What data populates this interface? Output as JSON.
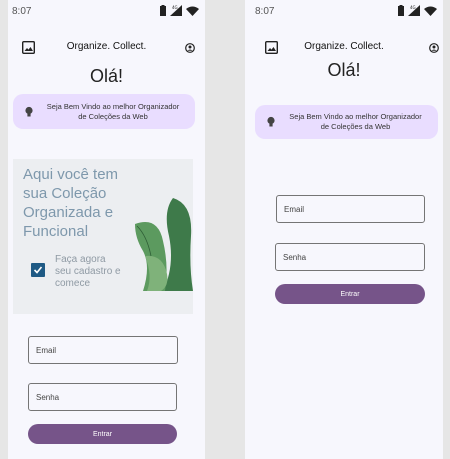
{
  "status": {
    "time": "8:07",
    "network": "4G"
  },
  "app": {
    "title": "Organize. Collect.",
    "image_icon": "image-icon",
    "account_icon": "account-circle-icon"
  },
  "greeting": "Olá!",
  "welcome": {
    "line1": "Seja Bem Vindo  ao melhor Organizador",
    "line2": "de Coleções da Web",
    "icon": "lightbulb-icon"
  },
  "promo": {
    "title_lines": [
      "Aqui você tem",
      "sua Coleção",
      "Organizada e",
      "Funcional"
    ],
    "cta_lines": [
      "Faça agora",
      "seu cadastro e",
      "comece"
    ]
  },
  "form": {
    "email_placeholder": "Email",
    "password_placeholder": "Senha",
    "submit_label": "Entrar"
  },
  "colors": {
    "accent": "#765489",
    "welcome_bg": "#e9ddff",
    "promo_bg": "#eceef1",
    "checkbox": "#1f5a85",
    "leaf": "#4e8a56"
  }
}
